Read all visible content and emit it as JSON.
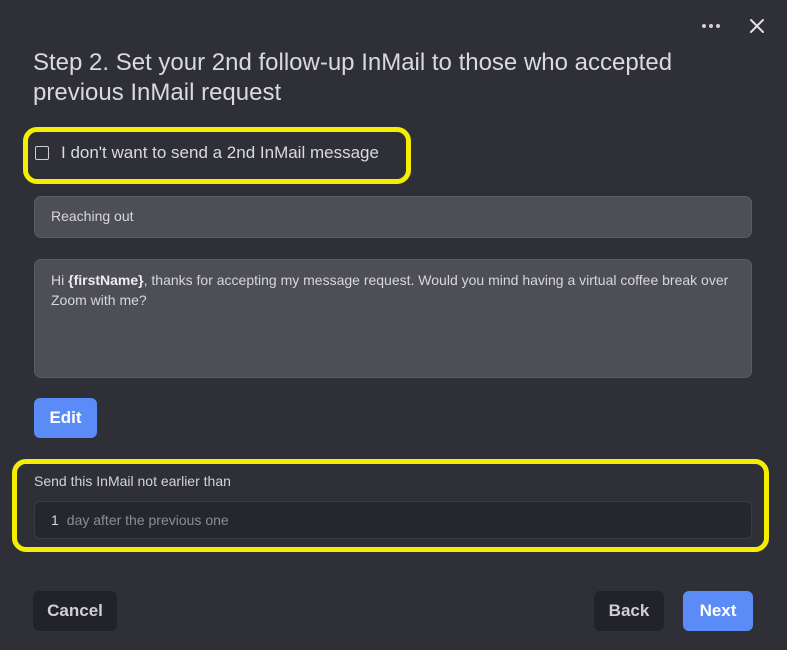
{
  "window": {
    "more_icon": "more-horizontal-icon",
    "close_icon": "close-icon"
  },
  "step_title": "Step 2. Set your 2nd follow-up InMail to those who accepted previous InMail request",
  "opt_out": {
    "label": "I don't want to send a 2nd InMail message",
    "checked": false
  },
  "message": {
    "subject": "Reaching out",
    "body_prefix": "Hi ",
    "body_variable": "{firstName}",
    "body_suffix": ", thanks for accepting my message request. Would you mind having a virtual coffee break over Zoom with me?"
  },
  "buttons": {
    "edit": "Edit",
    "cancel": "Cancel",
    "back": "Back",
    "next": "Next"
  },
  "delay": {
    "label": "Send this InMail not earlier than",
    "value": "1",
    "suffix": "day after the previous one"
  },
  "colors": {
    "background": "#2f3037",
    "accent": "#5b8bf7",
    "highlight": "#f6ee00"
  }
}
